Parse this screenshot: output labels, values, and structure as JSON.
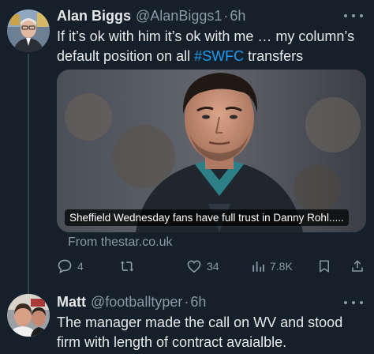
{
  "tweets": [
    {
      "author": "Alan Biggs",
      "handle": "@AlanBiggs1",
      "separator": "·",
      "time": "6h",
      "text_before": "If it’s ok with him it’s ok with me … my column’s default position on all ",
      "hashtag": "#SWFC",
      "text_after": " transfers",
      "card": {
        "caption": "Sheffield Wednesday fans have full trust in Danny Rohl.....",
        "source": "From thestar.co.uk"
      },
      "actions": {
        "replies": "4",
        "retweets": "",
        "likes": "34",
        "views": "7.8K"
      }
    },
    {
      "author": "Matt",
      "handle": "@footballtyper",
      "separator": "·",
      "time": "6h",
      "text": "The manager made the call on WV and stood firm with length of contract avaialble."
    }
  ],
  "colors": {
    "background": "#15202b",
    "text_primary": "#e7e9ea",
    "text_secondary": "#8b98a5",
    "link": "#1d9bf0",
    "thread_line": "#38444d"
  },
  "icons": {
    "reply": "speech-bubble-icon",
    "retweet": "retweet-arrows-icon",
    "like": "heart-icon",
    "views": "bar-chart-icon",
    "bookmark": "bookmark-icon",
    "share": "share-upload-icon",
    "more": "ellipsis-icon"
  }
}
